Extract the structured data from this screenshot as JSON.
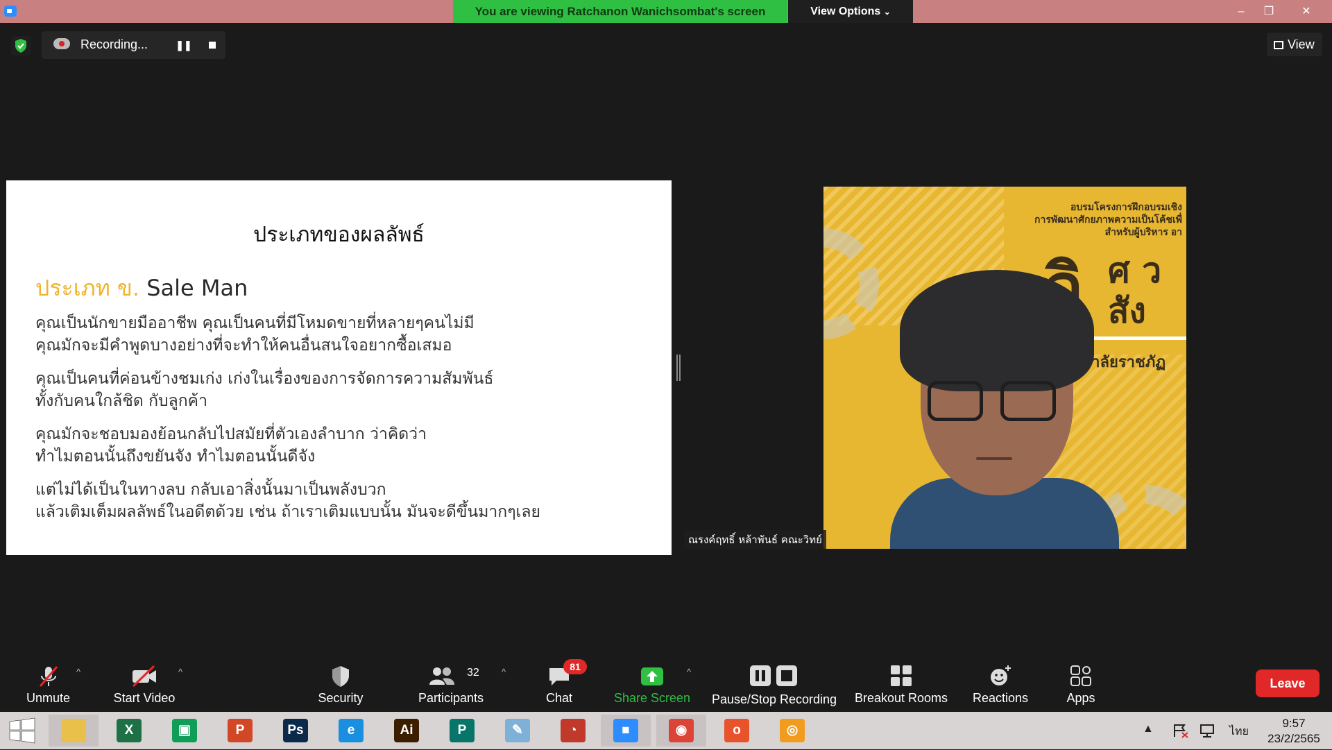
{
  "titlebar": {
    "viewing_banner": "You are viewing Ratchanon Wanichsombat's screen",
    "view_options": "View Options",
    "minimize": "–",
    "restore": "❐",
    "close": "✕"
  },
  "recording": {
    "status": "Recording...",
    "pause_glyph": "❚❚"
  },
  "view_button": {
    "label": "View"
  },
  "slide": {
    "title": "ประเภทของผลลัพธ์",
    "subtitle_accent": "ประเภท ข.",
    "subtitle_plain": "Sale Man",
    "paragraphs": [
      [
        "คุณเป็นนักขายมืออาชีพ คุณเป็นคนที่มีโหมดขายที่หลายๆคนไม่มี",
        "คุณมักจะมีคำพูดบางอย่างที่จะทำให้คนอื่นสนใจอยากซื้อเสมอ"
      ],
      [
        "คุณเป็นคนที่ค่อนข้างชมเก่ง เก่งในเรื่องของการจัดการความสัมพันธ์",
        "ทั้งกับคนใกล้ชิด กับลูกค้า"
      ],
      [
        "คุณมักจะชอบมองย้อนกลับไปสมัยที่ตัวเองลำบาก ว่าคิดว่า",
        "ทำไมตอนนั้นถึงขยันจัง ทำไมตอนนั้นดีจัง"
      ],
      [
        "แต่ไม่ได้เป็นในทางลบ กลับเอาสิ่งนั้นมาเป็นพลังบวก",
        "แล้วเติมเต็มผลลัพธ์ในอดีตด้วย เช่น ถ้าเราเติมแบบนั้น มันจะดีขึ้นมากๆเลย"
      ]
    ]
  },
  "participant_video": {
    "name": "ณรงค์ฤทธิ์ หล้าพันธ์ คณะวิทย์",
    "poster_line1": "อบรมโครงการฝึกอบรมเชิง",
    "poster_line2": "การพัฒนาศักยภาพความเป็นโค้ชเพื่",
    "poster_line3": "สำหรับผู้บริหาร อา",
    "poster_big": "วิ",
    "poster_big_rest": "ศ ว",
    "poster_big_rest2": "สัง",
    "poster_uni": "มหาวิทยาลัยราชภัฏ"
  },
  "toolbar": {
    "unmute": "Unmute",
    "start_video": "Start Video",
    "security": "Security",
    "participants": "Participants",
    "participants_count": "32",
    "chat": "Chat",
    "chat_badge": "81",
    "share_screen": "Share Screen",
    "pause_stop_recording": "Pause/Stop Recording",
    "breakout_rooms": "Breakout Rooms",
    "reactions": "Reactions",
    "apps": "Apps",
    "leave": "Leave",
    "caret": "^"
  },
  "taskbar": {
    "apps": [
      {
        "name": "file-explorer-icon",
        "glyph": "",
        "color": "#e8c04a"
      },
      {
        "name": "excel-icon",
        "glyph": "X",
        "color": "#1e7145"
      },
      {
        "name": "store-icon",
        "glyph": "▣",
        "color": "#0f9d58"
      },
      {
        "name": "powerpoint-icon",
        "glyph": "P",
        "color": "#d24726"
      },
      {
        "name": "photoshop-icon",
        "glyph": "Ps",
        "color": "#0b2a4a"
      },
      {
        "name": "internet-explorer-icon",
        "glyph": "e",
        "color": "#1a8fe0"
      },
      {
        "name": "illustrator-icon",
        "glyph": "Ai",
        "color": "#3b1d00"
      },
      {
        "name": "publisher-icon",
        "glyph": "P",
        "color": "#077568"
      },
      {
        "name": "notepad-icon",
        "glyph": "✎",
        "color": "#7fb0d8"
      },
      {
        "name": "photoscape-icon",
        "glyph": "◔",
        "color": "#c0392b"
      },
      {
        "name": "zoom-icon",
        "glyph": "■",
        "color": "#2d8cff"
      },
      {
        "name": "chrome-icon",
        "glyph": "◉",
        "color": "#db4437"
      },
      {
        "name": "office-icon",
        "glyph": "o",
        "color": "#e8532b"
      },
      {
        "name": "camera-app-icon",
        "glyph": "◎",
        "color": "#f29c1f"
      }
    ],
    "language": "ไทย",
    "time": "9:57",
    "date": "23/2/2565",
    "tray_up": "▲"
  }
}
